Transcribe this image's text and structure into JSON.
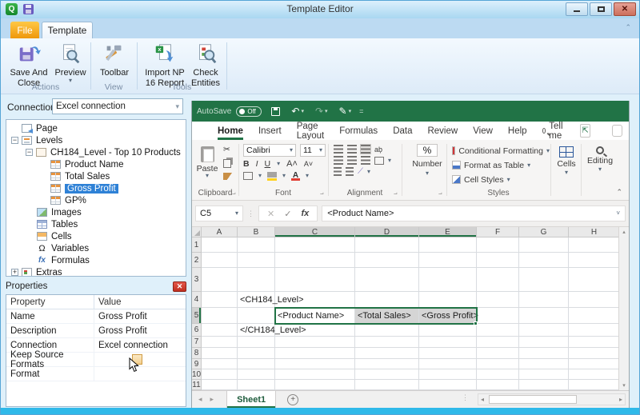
{
  "app": {
    "title": "Template Editor",
    "icon_letter": "Q"
  },
  "icons": {
    "close": "✕",
    "dropdown": "▾",
    "chevron_up": "⌃",
    "minus": "−",
    "plus": "+",
    "scissors": "✂",
    "undo": "↶",
    "redo": "↷",
    "pen": "✎",
    "omega": "Ω",
    "fx": "fx",
    "cancel": "✕",
    "check": "✓",
    "left_arrow": "◂",
    "right_arrow": "▸",
    "up_arrow": "▴",
    "down_arrow": "▾",
    "add": "+",
    "dots": "⋮",
    "wrap": "ab",
    "angle": "⟋"
  },
  "template_ribbon": {
    "tabs": [
      {
        "label": "File"
      },
      {
        "label": "Template",
        "active": true
      }
    ],
    "buttons": [
      {
        "label": "Save And Close"
      },
      {
        "label": "Preview",
        "dropdown": true
      },
      {
        "label": "Toolbar"
      },
      {
        "label": "Import NP 16 Report"
      },
      {
        "label": "Check Entities"
      }
    ],
    "group_labels": [
      "Actions",
      "View",
      "Tools"
    ]
  },
  "connection": {
    "label": "Connection",
    "value": "Excel connection"
  },
  "tree": {
    "items": [
      {
        "label": "Page"
      },
      {
        "label": "Levels"
      },
      {
        "label": "CH184_Level - Top 10 Products"
      },
      {
        "label": "Product Name"
      },
      {
        "label": "Total Sales"
      },
      {
        "label": "Gross Profit",
        "selected": true
      },
      {
        "label": "GP%"
      },
      {
        "label": "Images"
      },
      {
        "label": "Tables"
      },
      {
        "label": "Cells"
      },
      {
        "label": "Variables"
      },
      {
        "label": "Formulas"
      },
      {
        "label": "Extras"
      }
    ]
  },
  "properties": {
    "title": "Properties",
    "columns": [
      "Property",
      "Value"
    ],
    "rows": [
      {
        "property": "Name",
        "value": "Gross Profit"
      },
      {
        "property": "Description",
        "value": "Gross Profit"
      },
      {
        "property": "Connection",
        "value": "Excel connection"
      },
      {
        "property": "Keep Source Formats",
        "value": "",
        "checkbox": true
      },
      {
        "property": "Format",
        "value": ""
      }
    ]
  },
  "excel": {
    "quick_access": {
      "autosave_label": "AutoSave",
      "autosave_state": "Off"
    },
    "ribbon_tabs": [
      {
        "label": "Home",
        "active": true
      },
      {
        "label": "Insert"
      },
      {
        "label": "Page Layout"
      },
      {
        "label": "Formulas"
      },
      {
        "label": "Data"
      },
      {
        "label": "Review"
      },
      {
        "label": "View"
      },
      {
        "label": "Help"
      }
    ],
    "tell_me_label": "Tell me",
    "groups": {
      "clipboard": {
        "label": "Clipboard",
        "paste_label": "Paste"
      },
      "font": {
        "label": "Font",
        "font_name": "Calibri",
        "font_size": "11",
        "bold": "B",
        "italic": "I",
        "underline": "U",
        "grow": "A",
        "shrink": "A"
      },
      "alignment": {
        "label": "Alignment"
      },
      "number": {
        "label": "Number",
        "percent": "%"
      },
      "styles": {
        "label": "Styles",
        "items": [
          "Conditional Formatting",
          "Format as Table",
          "Cell Styles"
        ]
      },
      "cells": {
        "label": "Cells"
      },
      "editing": {
        "label": "Editing"
      }
    },
    "formula_bar": {
      "name_box": "C5",
      "fx": "fx",
      "value": "<Product Name>"
    },
    "grid": {
      "columns": [
        "A",
        "B",
        "C",
        "D",
        "E",
        "F",
        "G",
        "H"
      ],
      "rows": [
        "1",
        "2",
        "3",
        "4",
        "5",
        "6",
        "7",
        "8",
        "9",
        "10",
        "11"
      ],
      "cells": {
        "b4": "<CH184_Level>",
        "c5": "<Product Name>",
        "d5": "<Total Sales>",
        "e5": "<Gross Profit>",
        "b6": "</CH184_Level>"
      },
      "selection": "C5:E5",
      "active_cell": "C5"
    },
    "sheet_tabs": {
      "active": "Sheet1"
    }
  }
}
